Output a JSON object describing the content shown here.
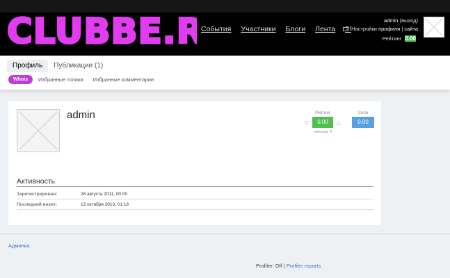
{
  "header": {
    "logo_text": "CLUBBE.RU",
    "nav": [
      "События",
      "Участники",
      "Блоги",
      "Лента",
      "?!"
    ],
    "user": {
      "name": "admin",
      "logout": "(выход)",
      "settings_prefix": "Настройки",
      "profile_link": "профиля",
      "separator": "|",
      "site_link": "сайта",
      "rating_label": "Рейтинг",
      "rating_value": "0.00"
    },
    "colors": {
      "logo": "#e13cf0",
      "background": "#000000"
    }
  },
  "tabs": [
    {
      "label": "Профиль",
      "active": true
    },
    {
      "label": "Публикации (1)",
      "active": false
    }
  ],
  "subtabs": {
    "active": "Whois",
    "links": [
      "Избранные топики",
      "Избранные комментарии"
    ]
  },
  "profile": {
    "name": "admin",
    "rating_label": "Рейтинг",
    "rating_value": "0.00",
    "votes": "голосов: 0",
    "power_label": "Сила",
    "power_value": "0.00",
    "activity_title": "Активность",
    "rows": [
      {
        "key": "Зарегистрирован:",
        "value": "28 августа 2011, 00:00"
      },
      {
        "key": "Последний визит:",
        "value": "13 октября 2013, 01:18"
      }
    ]
  },
  "footer": {
    "admin_link": "Админка",
    "profiler_prefix": "Profiler: Off |",
    "profiler_link": "Profiler reports"
  }
}
